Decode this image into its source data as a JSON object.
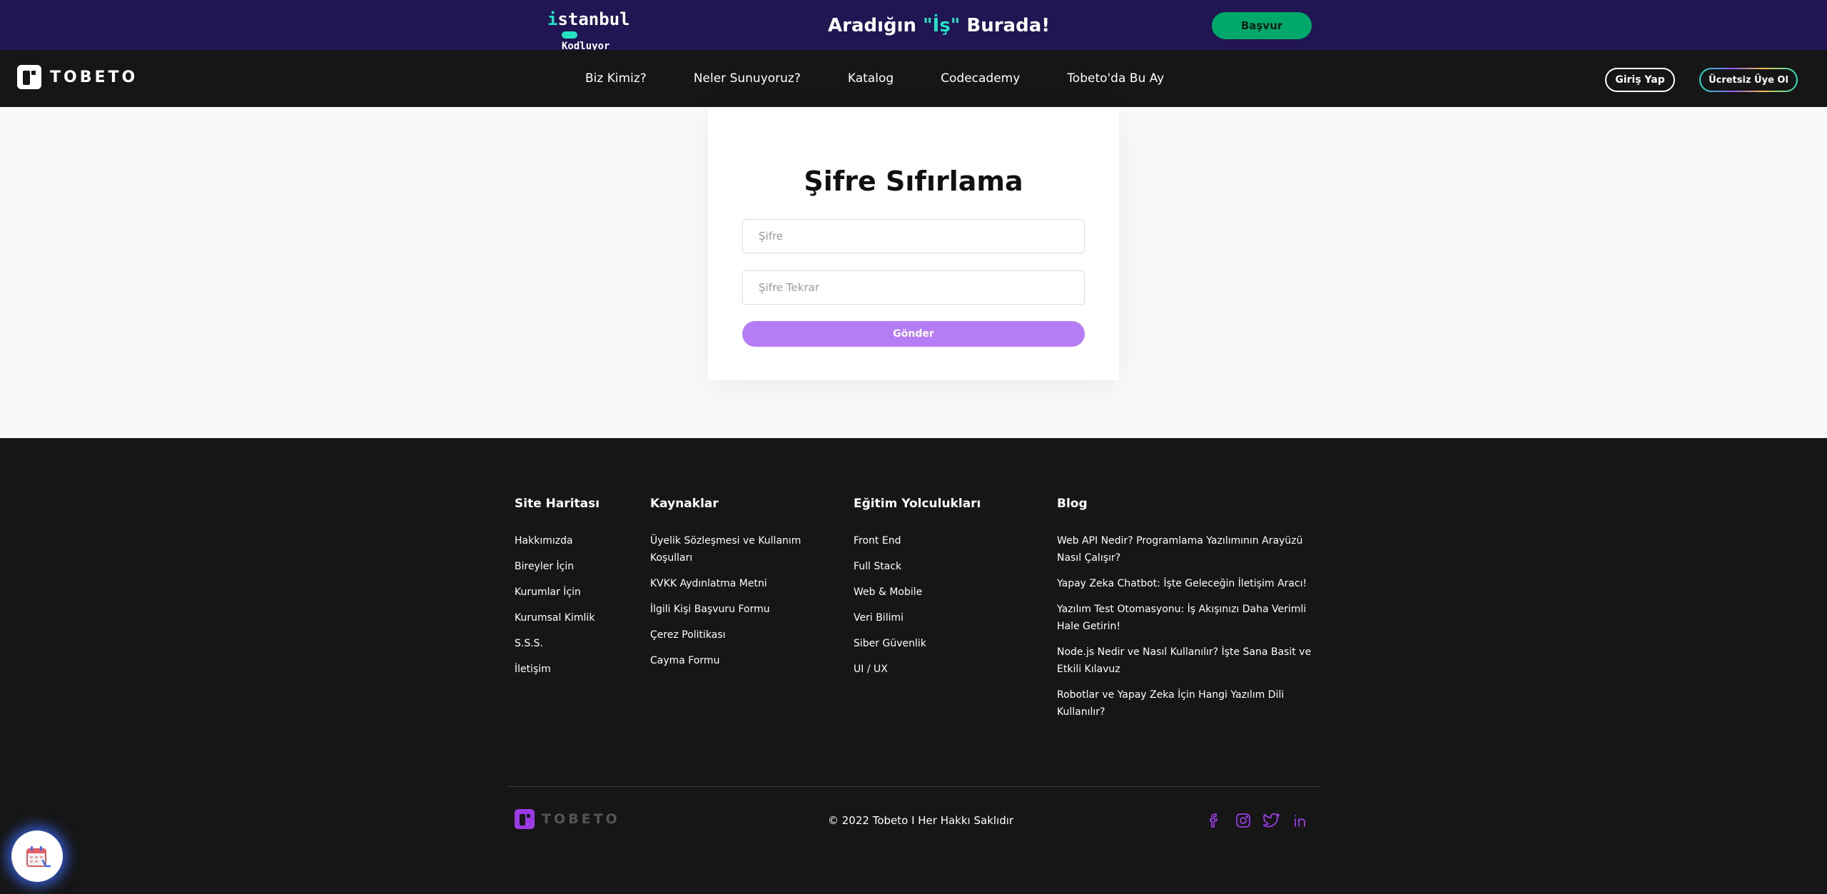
{
  "banner": {
    "logo_line1_accent": "i",
    "logo_line1_rest": "stanbul",
    "logo_line2": "Kodluyor",
    "title_part1": "Aradığın ",
    "title_highlight": "\"İş\"",
    "title_part2": " Burada!",
    "apply_label": "Başvur",
    "colors": {
      "background": "#221553",
      "accent": "#23e3c4",
      "button": "#00a86b"
    }
  },
  "nav": {
    "brand": "TOBETO",
    "links": [
      "Biz Kimiz?",
      "Neler Sunuyoruz?",
      "Katalog",
      "Codecademy",
      "Tobeto'da Bu Ay"
    ],
    "login_label": "Giriş Yap",
    "signup_label": "Ücretsiz Üye Ol"
  },
  "form": {
    "title": "Şifre Sıfırlama",
    "password_placeholder": "Şifre",
    "password_repeat_placeholder": "Şifre Tekrar",
    "submit_label": "Gönder",
    "colors": {
      "submit": "#b57cf6"
    }
  },
  "footer": {
    "columns": [
      {
        "title": "Site Haritası",
        "links": [
          "Hakkımızda",
          "Bireyler İçin",
          "Kurumlar İçin",
          "Kurumsal Kimlik",
          "S.S.S.",
          "İletişim"
        ]
      },
      {
        "title": "Kaynaklar",
        "links": [
          "Üyelik Sözleşmesi ve Kullanım Koşulları",
          "KVKK Aydınlatma Metni",
          "İlgili Kişi Başvuru Formu",
          "Çerez Politikası",
          "Cayma Formu"
        ]
      },
      {
        "title": "Eğitim Yolculukları",
        "links": [
          "Front End",
          "Full Stack",
          "Web & Mobile",
          "Veri Bilimi",
          "Siber Güvenlik",
          "UI / UX"
        ]
      },
      {
        "title": "Blog",
        "links": [
          "Web API Nedir? Programlama Yazılımının Arayüzü Nasıl Çalışır?",
          "Yapay Zeka Chatbot: İşte Geleceğin İletişim Aracı!",
          "Yazılım Test Otomasyonu: İş Akışınızı Daha Verimli Hale Getirin!",
          "Node.js Nedir ve Nasıl Kullanılır? İşte Sana Basit ve Etkili Kılavuz",
          "Robotlar ve Yapay Zeka İçin Hangi Yazılım Dili Kullanılır?"
        ]
      }
    ],
    "brand": "TOBETO",
    "copyright": "© 2022 Tobeto I Her Hakkı Saklıdır",
    "socials": [
      "facebook-icon",
      "instagram-icon",
      "twitter-icon",
      "linkedin-icon"
    ],
    "colors": {
      "background": "#161616",
      "social": "#9a3ce6"
    }
  },
  "widget": {
    "icon": "calendar-widget-icon"
  }
}
